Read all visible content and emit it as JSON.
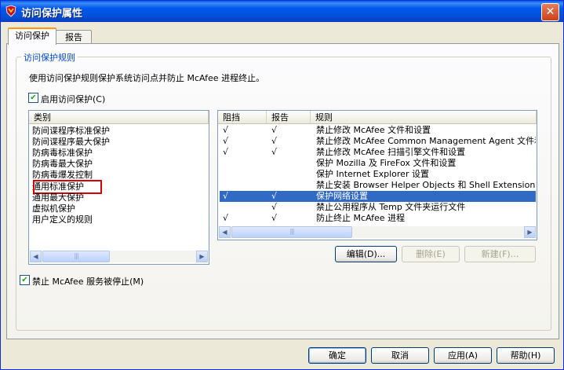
{
  "window": {
    "title": "访问保护属性",
    "close_glyph": "✕",
    "app_icon": "mcafee-shield-icon"
  },
  "tabs": [
    "访问保护",
    "报告"
  ],
  "group": {
    "title": "访问保护规则",
    "description": "使用访问保护规则保护系统访问点并防止 McAfee 进程终止。",
    "enable_checkbox": {
      "label": "启用访问保护(C)",
      "checked": true,
      "check_glyph": "✔"
    }
  },
  "categories": {
    "header": "类别",
    "items": [
      "防间谍程序标准保护",
      "防间谍程序最大保护",
      "防病毒标准保护",
      "防病毒最大保护",
      "防病毒爆发控制",
      "通用标准保护",
      "通用最大保护",
      "虚拟机保护",
      "用户定义的规则"
    ],
    "highlighted": "通用标准保护"
  },
  "rules": {
    "columns": [
      "阻挡",
      "报告",
      "规则"
    ],
    "rows": [
      {
        "block": "√",
        "report": "√",
        "rule": "禁止修改 McAfee 文件和设置"
      },
      {
        "block": "√",
        "report": "√",
        "rule": "禁止修改 McAfee Common Management Agent 文件和设"
      },
      {
        "block": "√",
        "report": "√",
        "rule": "禁止修改 McAfee 扫描引擎文件和设置"
      },
      {
        "block": "",
        "report": "",
        "rule": "保护 Mozilla 及 FireFox 文件和设置"
      },
      {
        "block": "",
        "report": "",
        "rule": "保护 Internet Explorer 设置"
      },
      {
        "block": "",
        "report": "",
        "rule": "禁止安装 Browser Helper Objects 和 Shell Extensions"
      },
      {
        "block": "√",
        "report": "√",
        "rule": "保护网络设置",
        "selected": true
      },
      {
        "block": "",
        "report": "√",
        "rule": "禁止公用程序从 Temp 文件夹运行文件"
      },
      {
        "block": "√",
        "report": "√",
        "rule": "防止终止 McAfee 进程"
      }
    ]
  },
  "scroll": {
    "left_glyph": "◀",
    "right_glyph": "▶",
    "grip_glyph": "|||"
  },
  "rule_buttons": {
    "edit": "编辑(D)...",
    "delete": "删除(E)",
    "new": "新建(F)..."
  },
  "service_checkbox": {
    "label": "禁止 McAfee 服务被停止(M)",
    "checked": true
  },
  "footer_buttons": {
    "ok": "确定",
    "cancel": "取消",
    "apply": "应用(A)",
    "help": "帮助(H)"
  }
}
